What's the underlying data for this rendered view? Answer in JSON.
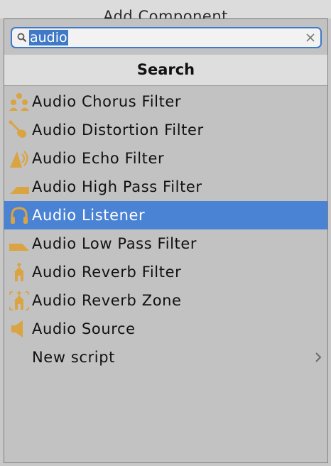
{
  "window": {
    "title": "Add Component"
  },
  "search": {
    "value": "audio"
  },
  "header": {
    "label": "Search"
  },
  "colors": {
    "icon_accent": "#d9a441",
    "selection": "#4a83d4",
    "focus_border": "#3f79c8"
  },
  "items": [
    {
      "label": "Audio Chorus Filter",
      "icon": "audio-chorus-filter-icon"
    },
    {
      "label": "Audio Distortion Filter",
      "icon": "audio-distortion-filter-icon"
    },
    {
      "label": "Audio Echo Filter",
      "icon": "audio-echo-filter-icon"
    },
    {
      "label": "Audio High Pass Filter",
      "icon": "audio-high-pass-filter-icon"
    },
    {
      "label": "Audio Listener",
      "icon": "headphones-icon",
      "selected": true
    },
    {
      "label": "Audio Low Pass Filter",
      "icon": "audio-low-pass-filter-icon"
    },
    {
      "label": "Audio Reverb Filter",
      "icon": "audio-reverb-filter-icon"
    },
    {
      "label": "Audio Reverb Zone",
      "icon": "audio-reverb-zone-icon"
    },
    {
      "label": "Audio Source",
      "icon": "speaker-icon"
    },
    {
      "label": "New script",
      "icon": "",
      "has_submenu": true
    }
  ]
}
